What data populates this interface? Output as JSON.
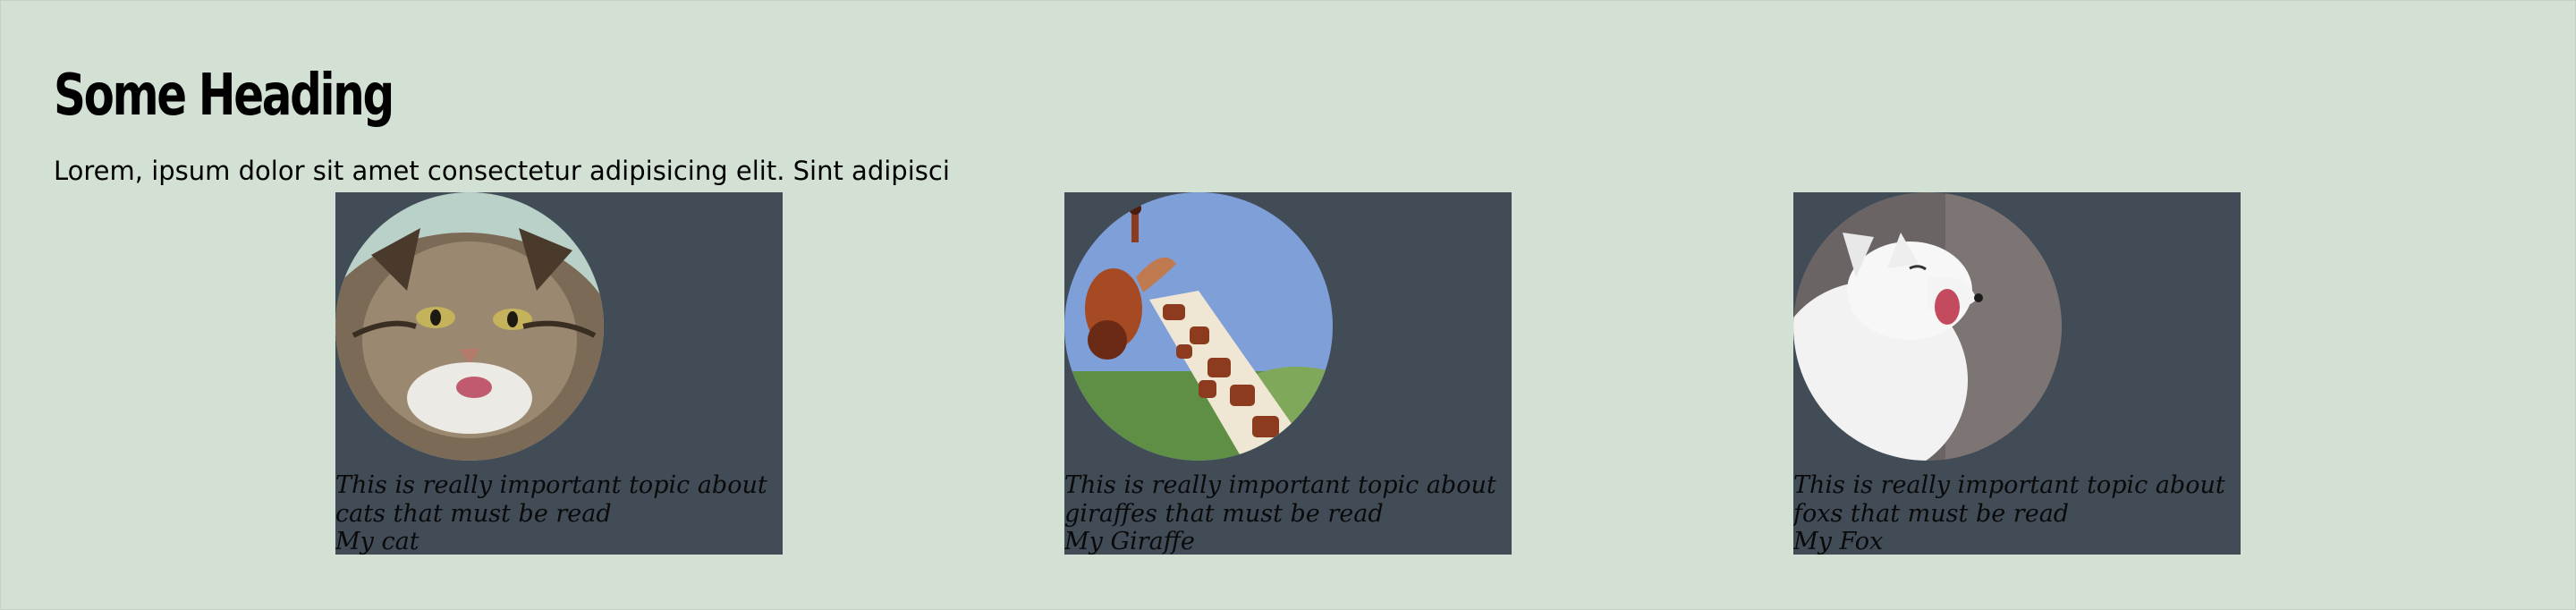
{
  "heading": "Some Heading",
  "intro": "Lorem, ipsum dolor sit amet consectetur adipisicing elit. Sint adipisci",
  "cards": [
    {
      "image_name": "cat-photo",
      "text": "This is really important topic about cats that must be read",
      "title": "My cat"
    },
    {
      "image_name": "giraffe-photo",
      "text": "This is really important topic about giraffes that must be read",
      "title": "My Giraffe"
    },
    {
      "image_name": "fox-photo",
      "text": "This is really important topic about foxs that must be read",
      "title": "My Fox"
    }
  ],
  "colors": {
    "background": "#d2e1d3",
    "card": "#414c57"
  }
}
